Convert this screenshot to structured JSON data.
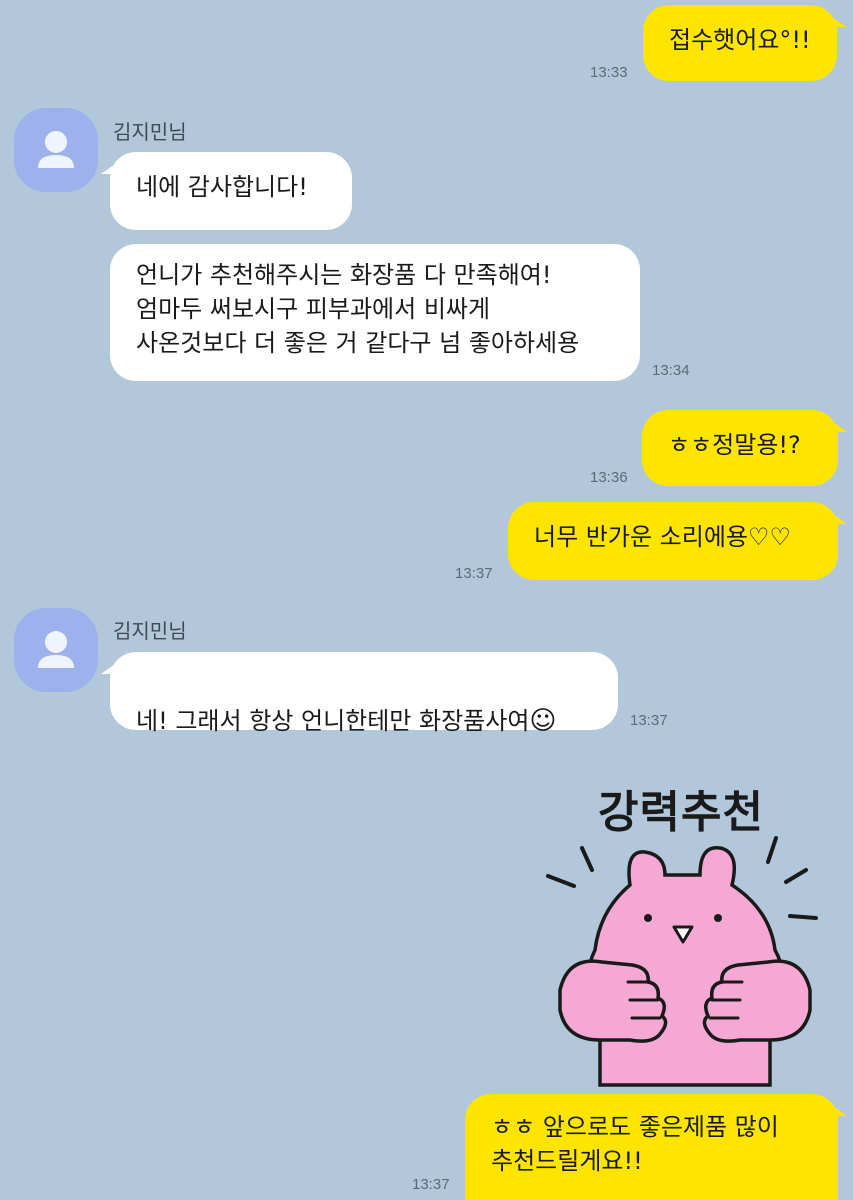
{
  "contact": {
    "name": "김지민님"
  },
  "messages": [
    {
      "id": "m1",
      "side": "mine",
      "text": "접수햇어요°!!",
      "time": "13:33"
    },
    {
      "id": "m2",
      "side": "theirs",
      "text": "네에 감사합니다!",
      "time": ""
    },
    {
      "id": "m3",
      "side": "theirs",
      "text": "언니가 추천해주시는 화장품 다 만족해여!\n엄마두 써보시구 피부과에서 비싸게\n사온것보다 더 좋은 거 같다구 넘 좋아하세용",
      "time": "13:34"
    },
    {
      "id": "m4",
      "side": "mine",
      "text": "ㅎㅎ정말용!?",
      "time": "13:36"
    },
    {
      "id": "m5",
      "side": "mine",
      "text": "너무 반가운 소리에용♡♡",
      "time": "13:37"
    },
    {
      "id": "m6",
      "side": "theirs",
      "text": "네! 그래서 항상 언니한테만 화장품사여",
      "emoji": "☺",
      "time": "13:37"
    },
    {
      "id": "m7",
      "side": "mine",
      "type": "sticker",
      "caption": "강력추천",
      "icon": "pink-rabbit-thumbs-up-sticker"
    },
    {
      "id": "m8",
      "side": "mine",
      "text": "ㅎㅎ 앞으로도 좋은제품 많이\n추천드릴게요!!",
      "time": "13:37"
    }
  ],
  "colors": {
    "background": "#b2c7da",
    "my_bubble": "#fee500",
    "their_bubble": "#ffffff",
    "avatar": "#9db2ec"
  }
}
